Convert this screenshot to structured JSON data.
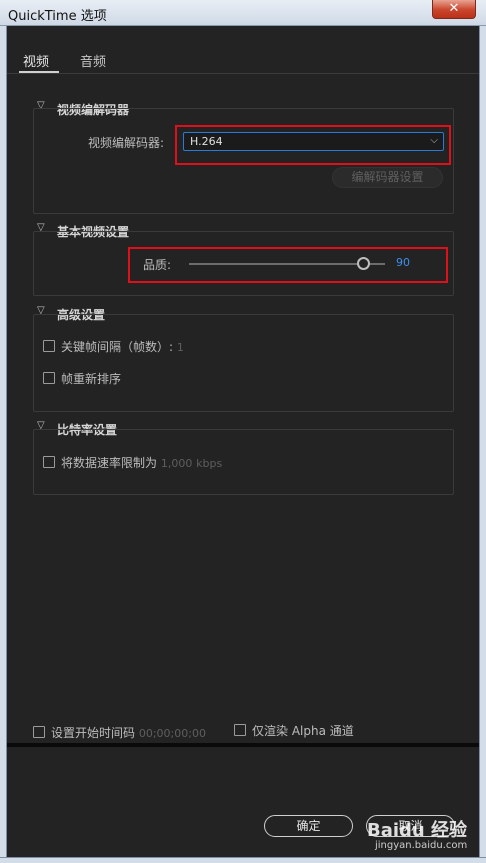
{
  "window": {
    "title": "QuickTime 选项",
    "close_glyph": "✕"
  },
  "tabs": [
    {
      "label": "视频",
      "active": true
    },
    {
      "label": "音频",
      "active": false
    }
  ],
  "video_codec": {
    "section_title": "视频编解码器",
    "codec_label": "视频编解码器:",
    "codec_value": "H.264",
    "codec_settings_button": "编解码器设置"
  },
  "basic_video": {
    "section_title": "基本视频设置",
    "quality_label": "品质:",
    "quality_value": "90",
    "quality_max": 100
  },
  "advanced": {
    "section_title": "高级设置",
    "keyframe_label": "关键帧间隔（帧数）:",
    "keyframe_value": "1",
    "reorder_label": "帧重新排序"
  },
  "bitrate": {
    "section_title": "比特率设置",
    "limit_label": "将数据速率限制为",
    "limit_value": "1,000",
    "limit_unit": "kbps"
  },
  "bottom": {
    "timecode_label": "设置开始时间码",
    "timecode_value": "00;00;00;00",
    "alpha_label": "仅渲染 Alpha 通道"
  },
  "buttons": {
    "ok": "确定",
    "cancel": "取消"
  },
  "watermark": {
    "text": "Baidu 经验",
    "url": "jingyan.baidu.com"
  },
  "colors": {
    "accent": "#2a7bd6",
    "value_blue": "#3a8ff0",
    "highlight_red": "#e0101a",
    "background": "#232323"
  }
}
